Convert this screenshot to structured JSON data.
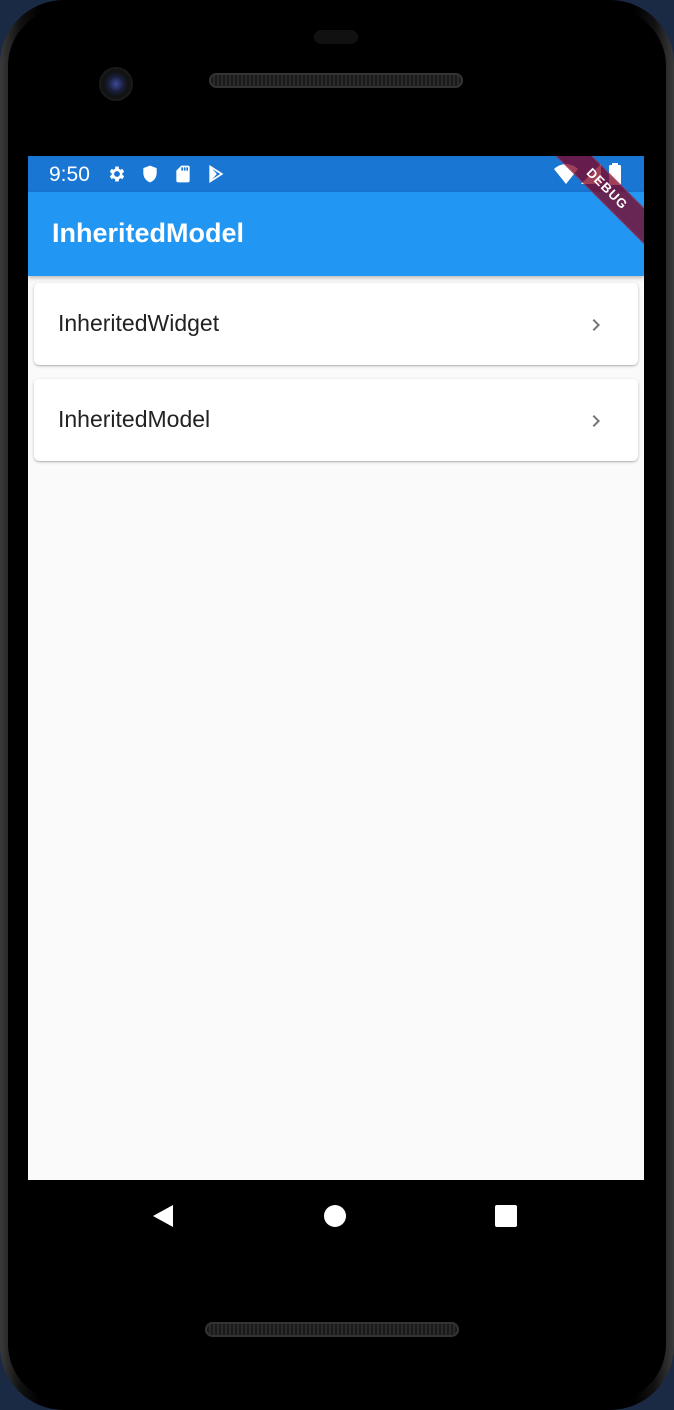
{
  "status_bar": {
    "time": "9:50",
    "icons": [
      "gear-icon",
      "shield-icon",
      "sd-card-icon",
      "play-store-icon",
      "wifi-icon",
      "signal-icon",
      "battery-icon"
    ]
  },
  "app_bar": {
    "title": "InheritedModel",
    "color": "#2196f3",
    "debug_label": "DEBUG"
  },
  "list": {
    "items": [
      {
        "label": "InheritedWidget",
        "icon": "chevron-right-icon"
      },
      {
        "label": "InheritedModel",
        "icon": "chevron-right-icon"
      }
    ]
  },
  "nav_bar": {
    "buttons": [
      "back-icon",
      "home-icon",
      "recents-icon"
    ]
  }
}
